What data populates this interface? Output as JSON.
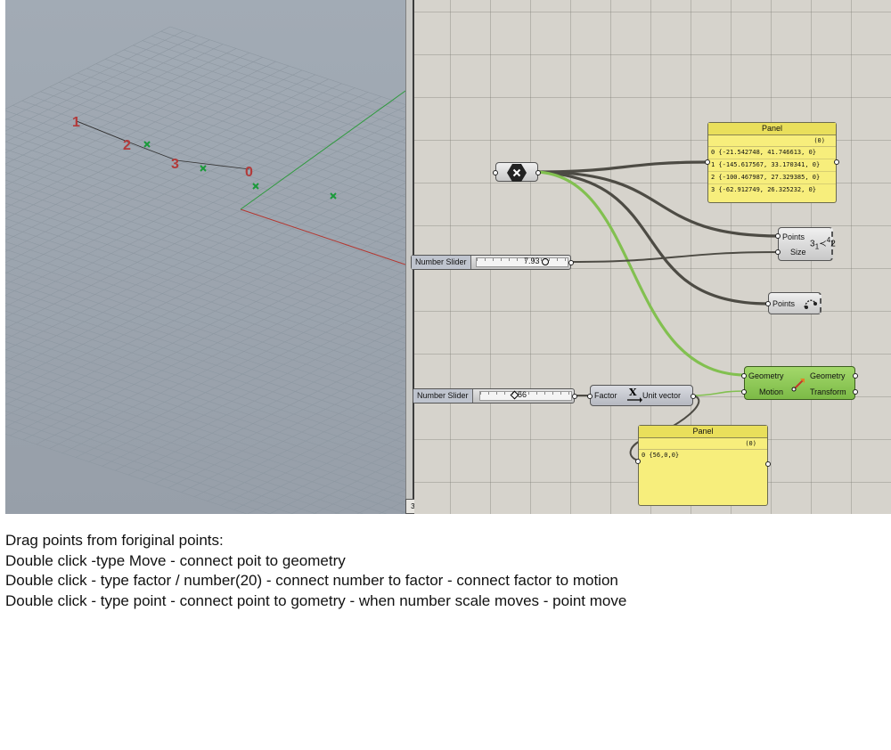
{
  "viewport": {
    "point_labels": [
      "1",
      "2",
      "3",
      "0"
    ]
  },
  "nodes": {
    "panel_top": {
      "title": "Panel",
      "count": "(0)",
      "rows": [
        "0 {-21.542748, 41.746613, 0}",
        "1 {-145.617567, 33.170341, 0}",
        "2 {-100.467987, 27.329385, 0}",
        "3 {-62.912749, 26.325232, 0}"
      ]
    },
    "points_size": {
      "points_label": "Points",
      "size_label": "Size",
      "icon": "point-list-icon"
    },
    "points_param": {
      "label": "Points",
      "icon": "point-param-icon"
    },
    "slider1": {
      "name": "Number Slider",
      "value": "7.93"
    },
    "slider2": {
      "name": "Number Slider",
      "value": "56"
    },
    "unit_vector": {
      "in_label": "Factor",
      "out_label": "Unit vector",
      "icon": "unit-x-vector-icon"
    },
    "move": {
      "in1": "Geometry",
      "in2": "Motion",
      "out1": "Geometry",
      "out2": "Transform",
      "icon": "move-arrow-icon"
    },
    "panel_bottom": {
      "title": "Panel",
      "count": "(0)",
      "rows": [
        "0 {56,0,0}"
      ]
    },
    "point_hub": {
      "icon": "point-param-hex-icon"
    }
  },
  "instructions": [
    "Drag points from foriginal points:",
    "Double click -type Move - connect poit to geometry",
    "Double click - type factor / number(20) - connect number to factor - connect factor to motion",
    "Double click - type point - connect point to gometry - when number scale moves - point move"
  ],
  "colors": {
    "wire_dark": "#4d4b44",
    "wire_green": "#82c050",
    "panel_yellow": "#f7ee7c",
    "axis_x": "#b3362f",
    "axis_y": "#2f9a3e",
    "point_green": "#1a9a3a"
  }
}
